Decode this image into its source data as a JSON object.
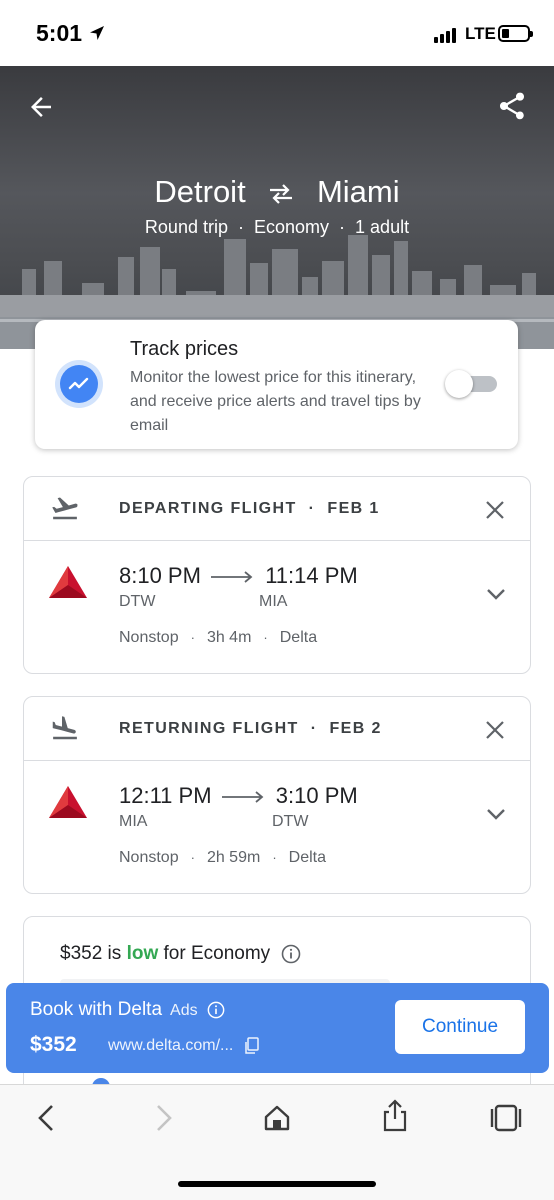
{
  "status_bar": {
    "time": "5:01",
    "network": "LTE",
    "signal_bars": 4,
    "battery_level": 0.2
  },
  "header": {
    "origin": "Detroit",
    "destination": "Miami",
    "trip_type": "Round trip",
    "cabin": "Economy",
    "passengers": "1 adult",
    "separator": "·"
  },
  "track_prices": {
    "title": "Track prices",
    "description": "Monitor the lowest price for this itinerary, and receive price alerts and travel tips by email",
    "enabled": false
  },
  "departing": {
    "label": "DEPARTING FLIGHT",
    "date": "FEB 1",
    "depart_time": "8:10 PM",
    "arrive_time": "11:14 PM",
    "from_code": "DTW",
    "to_code": "MIA",
    "stops": "Nonstop",
    "duration": "3h 4m",
    "airline": "Delta"
  },
  "returning": {
    "label": "RETURNING FLIGHT",
    "date": "FEB 2",
    "depart_time": "12:11 PM",
    "arrive_time": "3:10 PM",
    "from_code": "MIA",
    "to_code": "DTW",
    "stops": "Nonstop",
    "duration": "2h 59m",
    "airline": "Delta"
  },
  "price_insight": {
    "price": "$352",
    "is_text": " is ",
    "level": "low",
    "suffix": " for Economy"
  },
  "booking": {
    "title": "Book with Delta",
    "ads_label": "Ads",
    "price": "$352",
    "url": "www.delta.com/...",
    "cta": "Continue"
  },
  "colors": {
    "accent": "#4a86e8",
    "link": "#1a73e8",
    "low": "#34a853",
    "delta_red": "#c8102e"
  },
  "icons": {
    "back": "arrow-back-icon",
    "share": "share-icon",
    "swap": "swap-arrows-icon",
    "trend": "trending-icon",
    "takeoff": "flight-takeoff-icon",
    "landing": "flight-land-icon",
    "close": "close-icon",
    "expand": "chevron-down-icon",
    "info": "info-icon",
    "copy": "copy-link-icon",
    "nav_back": "chevron-left-icon",
    "nav_forward": "chevron-right-icon",
    "home": "home-icon",
    "share_sheet": "share-sheet-icon",
    "tabs": "tabs-icon"
  }
}
